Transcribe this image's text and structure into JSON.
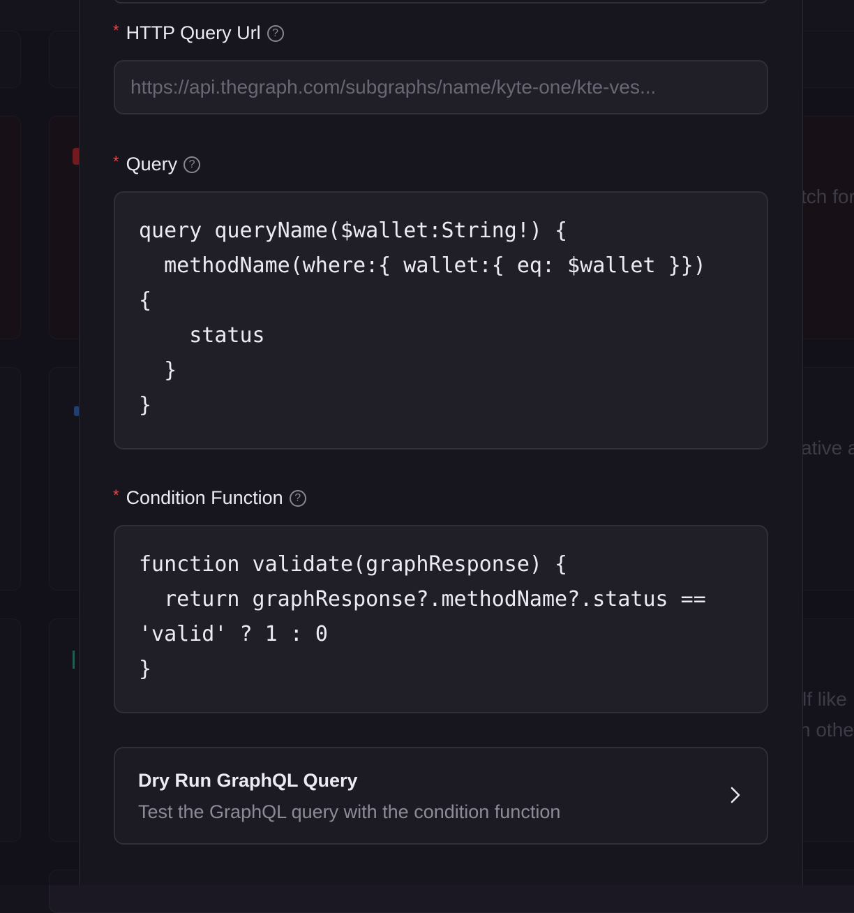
{
  "background": {
    "snippets": [
      "tch for",
      "ative a",
      "lf like",
      "n othe"
    ]
  },
  "form": {
    "http_query_url": {
      "label": "HTTP Query Url",
      "placeholder": "https://api.thegraph.com/subgraphs/name/kyte-one/kte-ves..."
    },
    "query": {
      "label": "Query",
      "code": "query queryName($wallet:String!) {\n  methodName(where:{ wallet:{ eq: $wallet }})\n{\n    status\n  }\n}"
    },
    "condition_function": {
      "label": "Condition Function",
      "code": "function validate(graphResponse) {\n  return graphResponse?.methodName?.status ==\n'valid' ? 1 : 0\n}"
    },
    "required_marker": "*",
    "help_glyph": "?"
  },
  "dry_run": {
    "title": "Dry Run GraphQL Query",
    "subtitle": "Test the GraphQL query with the condition function"
  },
  "colors": {
    "panel": "#17161e",
    "field": "#201f28",
    "border": "#302e39",
    "required": "#e5484d",
    "text": "#ecebf1",
    "muted": "#8e8b98"
  }
}
